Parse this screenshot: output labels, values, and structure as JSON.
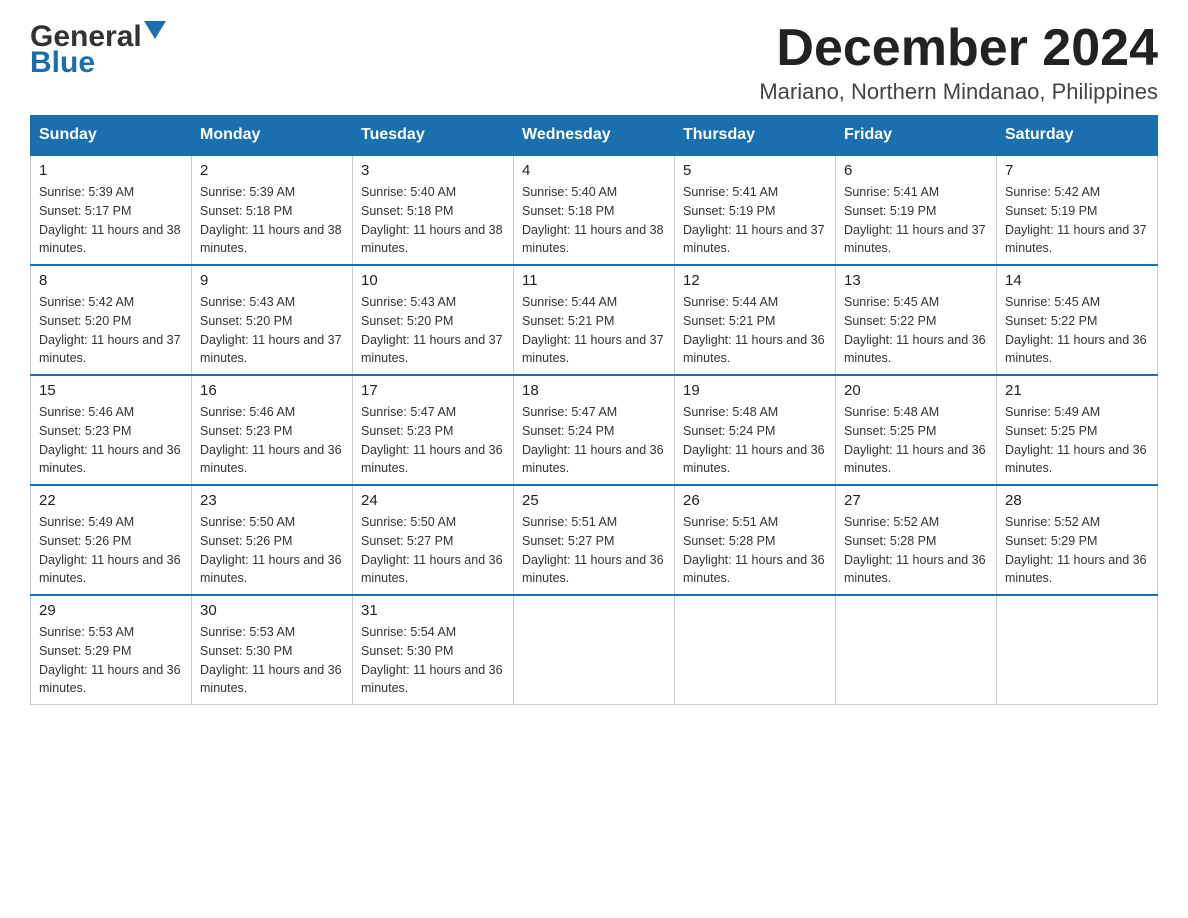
{
  "header": {
    "logo_general": "General",
    "logo_blue": "Blue",
    "month_year": "December 2024",
    "location": "Mariano, Northern Mindanao, Philippines"
  },
  "days_of_week": [
    "Sunday",
    "Monday",
    "Tuesday",
    "Wednesday",
    "Thursday",
    "Friday",
    "Saturday"
  ],
  "weeks": [
    [
      {
        "day": "1",
        "sunrise": "5:39 AM",
        "sunset": "5:17 PM",
        "daylight": "11 hours and 38 minutes."
      },
      {
        "day": "2",
        "sunrise": "5:39 AM",
        "sunset": "5:18 PM",
        "daylight": "11 hours and 38 minutes."
      },
      {
        "day": "3",
        "sunrise": "5:40 AM",
        "sunset": "5:18 PM",
        "daylight": "11 hours and 38 minutes."
      },
      {
        "day": "4",
        "sunrise": "5:40 AM",
        "sunset": "5:18 PM",
        "daylight": "11 hours and 38 minutes."
      },
      {
        "day": "5",
        "sunrise": "5:41 AM",
        "sunset": "5:19 PM",
        "daylight": "11 hours and 37 minutes."
      },
      {
        "day": "6",
        "sunrise": "5:41 AM",
        "sunset": "5:19 PM",
        "daylight": "11 hours and 37 minutes."
      },
      {
        "day": "7",
        "sunrise": "5:42 AM",
        "sunset": "5:19 PM",
        "daylight": "11 hours and 37 minutes."
      }
    ],
    [
      {
        "day": "8",
        "sunrise": "5:42 AM",
        "sunset": "5:20 PM",
        "daylight": "11 hours and 37 minutes."
      },
      {
        "day": "9",
        "sunrise": "5:43 AM",
        "sunset": "5:20 PM",
        "daylight": "11 hours and 37 minutes."
      },
      {
        "day": "10",
        "sunrise": "5:43 AM",
        "sunset": "5:20 PM",
        "daylight": "11 hours and 37 minutes."
      },
      {
        "day": "11",
        "sunrise": "5:44 AM",
        "sunset": "5:21 PM",
        "daylight": "11 hours and 37 minutes."
      },
      {
        "day": "12",
        "sunrise": "5:44 AM",
        "sunset": "5:21 PM",
        "daylight": "11 hours and 36 minutes."
      },
      {
        "day": "13",
        "sunrise": "5:45 AM",
        "sunset": "5:22 PM",
        "daylight": "11 hours and 36 minutes."
      },
      {
        "day": "14",
        "sunrise": "5:45 AM",
        "sunset": "5:22 PM",
        "daylight": "11 hours and 36 minutes."
      }
    ],
    [
      {
        "day": "15",
        "sunrise": "5:46 AM",
        "sunset": "5:23 PM",
        "daylight": "11 hours and 36 minutes."
      },
      {
        "day": "16",
        "sunrise": "5:46 AM",
        "sunset": "5:23 PM",
        "daylight": "11 hours and 36 minutes."
      },
      {
        "day": "17",
        "sunrise": "5:47 AM",
        "sunset": "5:23 PM",
        "daylight": "11 hours and 36 minutes."
      },
      {
        "day": "18",
        "sunrise": "5:47 AM",
        "sunset": "5:24 PM",
        "daylight": "11 hours and 36 minutes."
      },
      {
        "day": "19",
        "sunrise": "5:48 AM",
        "sunset": "5:24 PM",
        "daylight": "11 hours and 36 minutes."
      },
      {
        "day": "20",
        "sunrise": "5:48 AM",
        "sunset": "5:25 PM",
        "daylight": "11 hours and 36 minutes."
      },
      {
        "day": "21",
        "sunrise": "5:49 AM",
        "sunset": "5:25 PM",
        "daylight": "11 hours and 36 minutes."
      }
    ],
    [
      {
        "day": "22",
        "sunrise": "5:49 AM",
        "sunset": "5:26 PM",
        "daylight": "11 hours and 36 minutes."
      },
      {
        "day": "23",
        "sunrise": "5:50 AM",
        "sunset": "5:26 PM",
        "daylight": "11 hours and 36 minutes."
      },
      {
        "day": "24",
        "sunrise": "5:50 AM",
        "sunset": "5:27 PM",
        "daylight": "11 hours and 36 minutes."
      },
      {
        "day": "25",
        "sunrise": "5:51 AM",
        "sunset": "5:27 PM",
        "daylight": "11 hours and 36 minutes."
      },
      {
        "day": "26",
        "sunrise": "5:51 AM",
        "sunset": "5:28 PM",
        "daylight": "11 hours and 36 minutes."
      },
      {
        "day": "27",
        "sunrise": "5:52 AM",
        "sunset": "5:28 PM",
        "daylight": "11 hours and 36 minutes."
      },
      {
        "day": "28",
        "sunrise": "5:52 AM",
        "sunset": "5:29 PM",
        "daylight": "11 hours and 36 minutes."
      }
    ],
    [
      {
        "day": "29",
        "sunrise": "5:53 AM",
        "sunset": "5:29 PM",
        "daylight": "11 hours and 36 minutes."
      },
      {
        "day": "30",
        "sunrise": "5:53 AM",
        "sunset": "5:30 PM",
        "daylight": "11 hours and 36 minutes."
      },
      {
        "day": "31",
        "sunrise": "5:54 AM",
        "sunset": "5:30 PM",
        "daylight": "11 hours and 36 minutes."
      },
      null,
      null,
      null,
      null
    ]
  ],
  "labels": {
    "sunrise_prefix": "Sunrise: ",
    "sunset_prefix": "Sunset: ",
    "daylight_prefix": "Daylight: "
  }
}
